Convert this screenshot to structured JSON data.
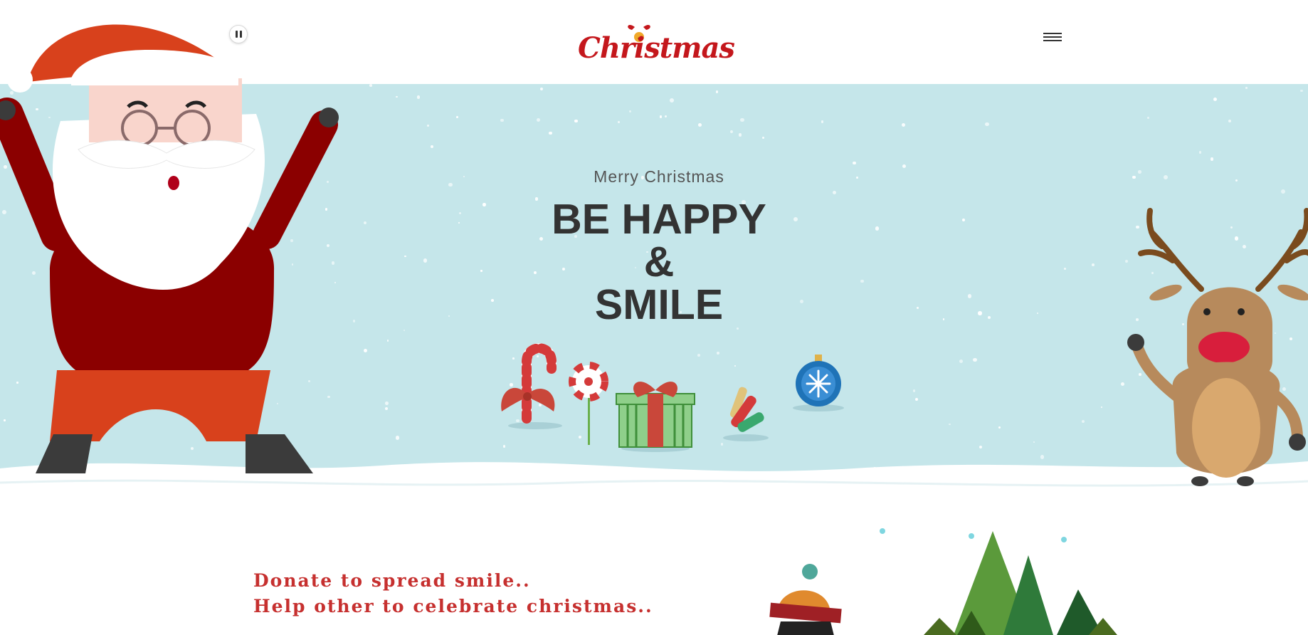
{
  "header": {
    "logo_text": "Christmas",
    "pause_icon": "pause-icon",
    "menu_icon": "hamburger-menu-icon"
  },
  "hero": {
    "eyebrow": "Merry Christmas",
    "headline_lines": [
      "BE HAPPY",
      "&",
      "SMILE"
    ],
    "background_color": "#c5e6ea"
  },
  "lower": {
    "donate_lines": [
      "Donate to spread smile..",
      "Help other to celebrate christmas.."
    ],
    "accent_color": "#c6302f"
  },
  "illustrations": {
    "left": "santa-illustration",
    "right": "reindeer-illustration",
    "ornaments": [
      "candy-cane-icon",
      "lollipop-icon",
      "gift-box-icon",
      "wrapped-candies-icon",
      "bauble-icon"
    ],
    "bottom": [
      "penguin-illustration",
      "pine-trees-illustration"
    ]
  }
}
